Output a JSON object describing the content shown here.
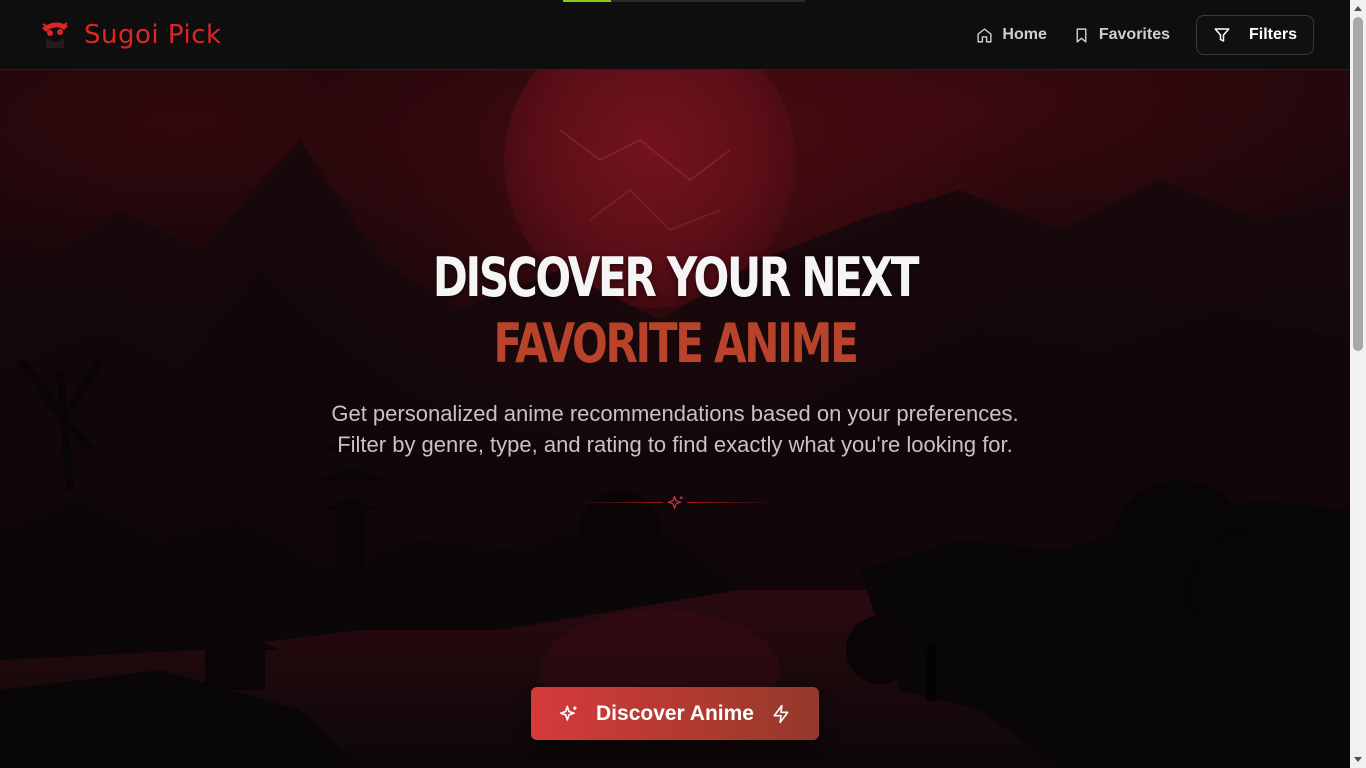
{
  "loading_progress": 0.2,
  "header": {
    "brand_name": "Sugoi Pick",
    "nav": [
      {
        "label": "Home",
        "icon": "home-icon"
      },
      {
        "label": "Favorites",
        "icon": "bookmark-icon"
      }
    ],
    "filters_label": "Filters",
    "filters_icon": "filter-icon"
  },
  "hero": {
    "title_line1": "DISCOVER YOUR NEXT",
    "title_line2": "FAVORITE ANIME",
    "subtitle_line1": "Get personalized anime recommendations based on your preferences.",
    "subtitle_line2": "Filter by genre, type, and rating to find exactly what you're looking for.",
    "divider_icon": "sparkle-icon",
    "cta_label": "Discover Anime",
    "cta_icon_left": "sparkles-icon",
    "cta_icon_right": "lightning-icon"
  },
  "colors": {
    "brand": "#dc2626",
    "title_accent": "#b8432a",
    "cta_start": "#d63a3a",
    "cta_end": "#93392b",
    "progress": "#84cc16"
  }
}
